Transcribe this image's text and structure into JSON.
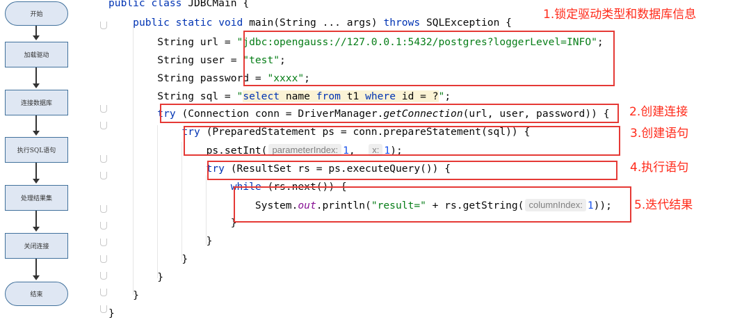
{
  "flowchart": {
    "steps": [
      "开始",
      "加载驱动",
      "连接数据库",
      "执行SQL语句",
      "处理结果集",
      "关闭连接",
      "结束"
    ]
  },
  "code": {
    "l0": {
      "a": "public",
      "b": " ",
      "c": "class",
      "d": " JDBCMain {"
    },
    "l1": {
      "a": "    ",
      "b": "public",
      "c": " ",
      "d": "static",
      "e": " ",
      "f": "void",
      "g": " main(String ... args) ",
      "h": "throws",
      "i": " SQLException {"
    },
    "l2": {
      "a": "        String url = ",
      "b": "\"jdbc:opengauss://127.0.0.1:5432/postgres?loggerLevel=INFO\"",
      "c": ";"
    },
    "l3": {
      "a": "        String user = ",
      "b": "\"test\"",
      "c": ";"
    },
    "l4": {
      "a": "        String password = ",
      "b": "\"xxxx\"",
      "c": ";"
    },
    "l5": {
      "a": "        String sql = ",
      "b": "\"",
      "c": "select",
      "d": " name ",
      "e": "from",
      "f": " t1 ",
      "g": "where",
      "h": " id = ?",
      "i": "\"",
      "j": ";"
    },
    "l6": {
      "a": "        ",
      "b": "try",
      "c": " (Connection conn = DriverManager.",
      "d": "getConnection",
      "e": "(url, user, password)) {"
    },
    "l7": {
      "a": "            ",
      "b": "try",
      "c": " (PreparedStatement ps = conn.prepareStatement(sql)) {"
    },
    "l8": {
      "a": "                ps.setInt(",
      "b": "parameterIndex:",
      "c": "1",
      "d": ",  ",
      "e": "x:",
      "f": "1",
      "g": ");"
    },
    "l9": {
      "a": "                ",
      "b": "try",
      "c": " (ResultSet rs = ps.executeQuery()) {"
    },
    "l10": {
      "a": "                    ",
      "b": "while",
      "c": " (rs.next()) {"
    },
    "l11": {
      "a": "                        System.",
      "b": "out",
      "c": ".println(",
      "d": "\"result=\"",
      "e": " + rs.getString(",
      "f": "columnIndex:",
      "g": "1",
      "h": "));"
    },
    "l12": {
      "a": "                    }"
    },
    "l13": {
      "a": "                }"
    },
    "l14": {
      "a": "            }"
    },
    "l15": {
      "a": "        }"
    },
    "l16": {
      "a": "    }"
    },
    "l17": {
      "a": "}"
    }
  },
  "annotations": {
    "a1": "1.锁定驱动类型和数据库信息",
    "a2": "2.创建连接",
    "a3": "3.创建语句",
    "a4": "4.执行语句",
    "a5": "5.迭代结果"
  },
  "colors": {
    "annotation_red": "#ff2a1a",
    "keyword_blue": "#0033b3",
    "string_green": "#067d17",
    "number_blue": "#1750eb",
    "flow_fill": "#dfe7f3",
    "flow_border": "#41719c"
  }
}
